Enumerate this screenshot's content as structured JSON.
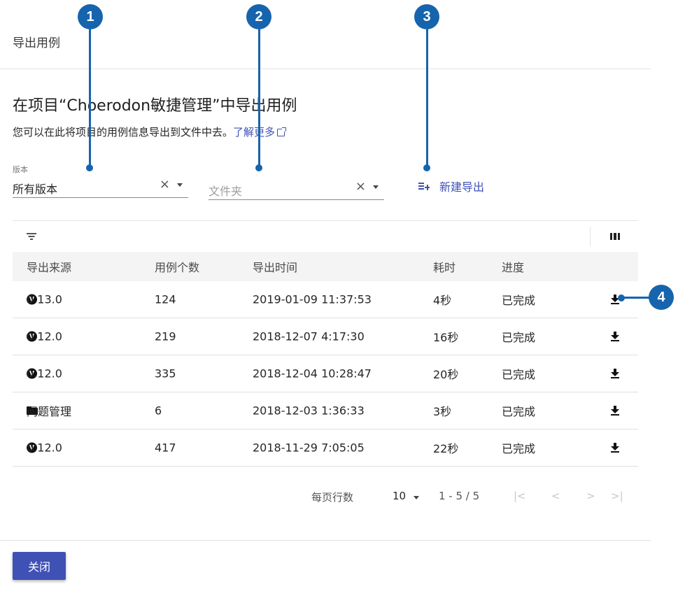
{
  "dialog": {
    "title": "导出用例",
    "close_label": "关闭"
  },
  "header": {
    "heading": "在项目“Choerodon敏捷管理”中导出用例",
    "description": "您可以在此将项目的用例信息导出到文件中去。",
    "learn_more": "了解更多"
  },
  "filters": {
    "version": {
      "label": "版本",
      "value": "所有版本",
      "clear": "×"
    },
    "folder": {
      "placeholder": "文件夹",
      "clear": "×"
    },
    "new_export_label": "新建导出"
  },
  "table": {
    "columns": [
      "导出来源",
      "用例个数",
      "导出时间",
      "耗时",
      "进度"
    ],
    "rows": [
      {
        "source_icon": "version-icon",
        "source": "0.13.0",
        "count": "124",
        "time": "2019-01-09 11:37:53",
        "duration": "4秒",
        "progress": "已完成"
      },
      {
        "source_icon": "version-icon",
        "source": "0.12.0",
        "count": "219",
        "time": "2018-12-07 4:17:30",
        "duration": "16秒",
        "progress": "已完成"
      },
      {
        "source_icon": "version-icon",
        "source": "0.12.0",
        "count": "335",
        "time": "2018-12-04 10:28:47",
        "duration": "20秒",
        "progress": "已完成"
      },
      {
        "source_icon": "folder-icon",
        "source": "问题管理",
        "count": "6",
        "time": "2018-12-03 1:36:33",
        "duration": "3秒",
        "progress": "已完成"
      },
      {
        "source_icon": "version-icon",
        "source": "0.12.0",
        "count": "417",
        "time": "2018-11-29 7:05:05",
        "duration": "22秒",
        "progress": "已完成"
      }
    ]
  },
  "pagination": {
    "rows_per_page_label": "每页行数",
    "page_size": "10",
    "range": "1 - 5 / 5",
    "first": "|<",
    "prev": "<",
    "next": ">",
    "last": ">|"
  },
  "callouts": [
    "1",
    "2",
    "3",
    "4"
  ],
  "colors": {
    "accent": "#3f51b5",
    "callout": "#1664ad"
  }
}
